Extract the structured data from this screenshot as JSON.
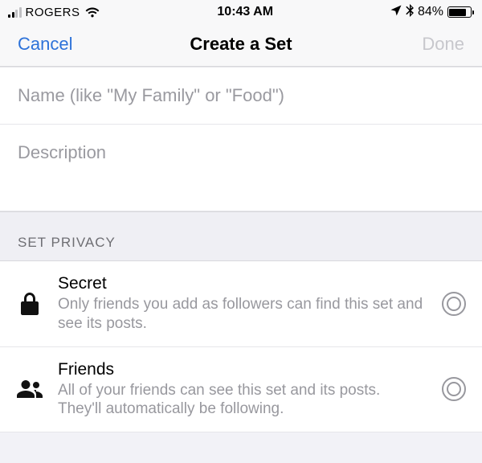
{
  "status": {
    "carrier": "ROGERS",
    "time": "10:43 AM",
    "battery_pct": "84%",
    "battery_fill_width": "84%"
  },
  "nav": {
    "cancel": "Cancel",
    "title": "Create a Set",
    "done": "Done"
  },
  "fields": {
    "name_placeholder": "Name (like \"My Family\" or \"Food\")",
    "description_placeholder": "Description"
  },
  "section": {
    "privacy_header": "SET PRIVACY"
  },
  "privacy": [
    {
      "title": "Secret",
      "desc": "Only friends you add as followers can find this set and see its posts."
    },
    {
      "title": "Friends",
      "desc": "All of your friends can see this set and its posts. They'll automatically be following."
    }
  ]
}
